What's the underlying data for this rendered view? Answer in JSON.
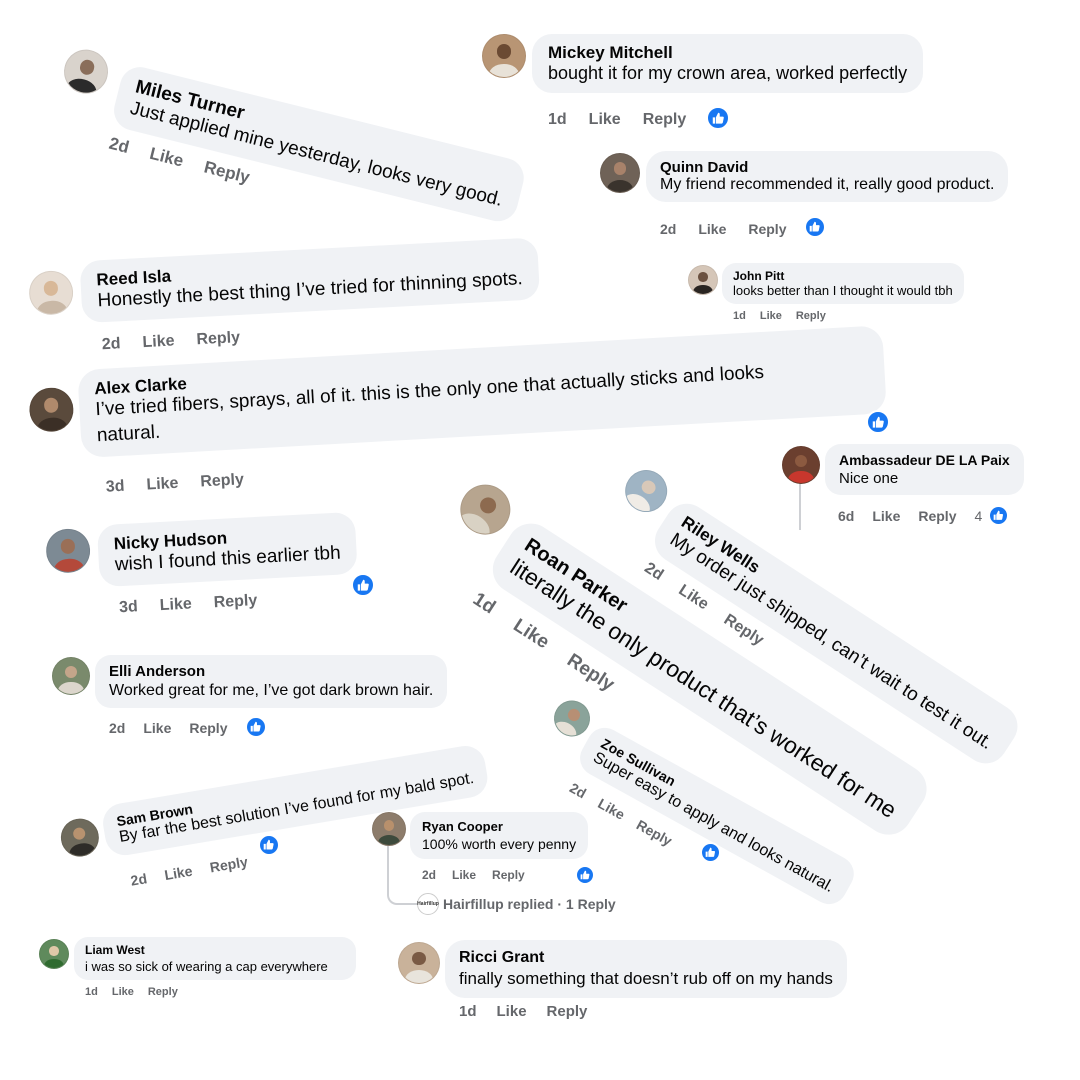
{
  "comments": {
    "miles": {
      "name": "Miles Turner",
      "text": "Just applied mine yesterday, looks very good.",
      "time": "2d",
      "like": "Like",
      "reply": "Reply"
    },
    "mickey": {
      "name": "Mickey Mitchell",
      "text": "bought it for my crown area, worked perfectly",
      "time": "1d",
      "like": "Like",
      "reply": "Reply"
    },
    "quinn": {
      "name": "Quinn David",
      "text": "My friend recommended it, really good product.",
      "time": "2d",
      "like": "Like",
      "reply": "Reply"
    },
    "reed": {
      "name": "Reed Isla",
      "text": "Honestly the best thing I’ve tried for thinning spots.",
      "time": "2d",
      "like": "Like",
      "reply": "Reply"
    },
    "john": {
      "name": "John Pitt",
      "text": "looks better than I thought it would tbh",
      "time": "1d",
      "like": "Like",
      "reply": "Reply"
    },
    "alex": {
      "name": "Alex Clarke",
      "text1": "I’ve tried fibers, sprays, all of it. this is the only one that actually sticks and looks",
      "text2": "natural.",
      "time": "3d",
      "like": "Like",
      "reply": "Reply"
    },
    "ambassadeur": {
      "name": "Ambassadeur DE LA Paix",
      "text": "Nice one",
      "time": "6d",
      "like": "Like",
      "reply": "Reply",
      "reaction_count": "4"
    },
    "nicky": {
      "name": "Nicky Hudson",
      "text": "wish I found this earlier tbh",
      "time": "3d",
      "like": "Like",
      "reply": "Reply"
    },
    "riley": {
      "name": "Riley Wells",
      "text": "My order just shipped, can’t wait to test it out.",
      "time": "2d",
      "like": "Like",
      "reply": "Reply"
    },
    "roan": {
      "name": "Roan Parker",
      "text": "literally the only product that’s worked for me",
      "time": "1d",
      "like": "Like",
      "reply": "Reply"
    },
    "elli": {
      "name": "Elli Anderson",
      "text": "Worked great for me, I’ve got dark brown hair.",
      "time": "2d",
      "like": "Like",
      "reply": "Reply"
    },
    "zoe": {
      "name": "Zoe Sullivan",
      "text": "Super easy to apply and looks natural.",
      "time": "2d",
      "like": "Like",
      "reply": "Reply"
    },
    "sam": {
      "name": "Sam Brown",
      "text": "By far the best solution I’ve found for my bald spot.",
      "time": "2d",
      "like": "Like",
      "reply": "Reply"
    },
    "ryan": {
      "name": "Ryan Cooper",
      "text": "100% worth every penny",
      "time": "2d",
      "like": "Like",
      "reply": "Reply"
    },
    "liam": {
      "name": "Liam West",
      "text": "i was so sick of wearing a cap everywhere",
      "time": "1d",
      "like": "Like",
      "reply": "Reply"
    },
    "ricci": {
      "name": "Ricci Grant",
      "text": "finally something that doesn’t rub off on my hands",
      "time": "1d",
      "like": "Like",
      "reply": "Reply"
    }
  },
  "replied_thread": {
    "label": "Hairfillup replied · 1 Reply",
    "avatar_text": "Hairfillup"
  },
  "colors": {
    "bubble": "#f0f2f5",
    "meta": "#65676b",
    "like_blue": "#1877f2",
    "text": "#050505"
  },
  "icons": {
    "like_reaction": "thumbs-up-icon"
  }
}
